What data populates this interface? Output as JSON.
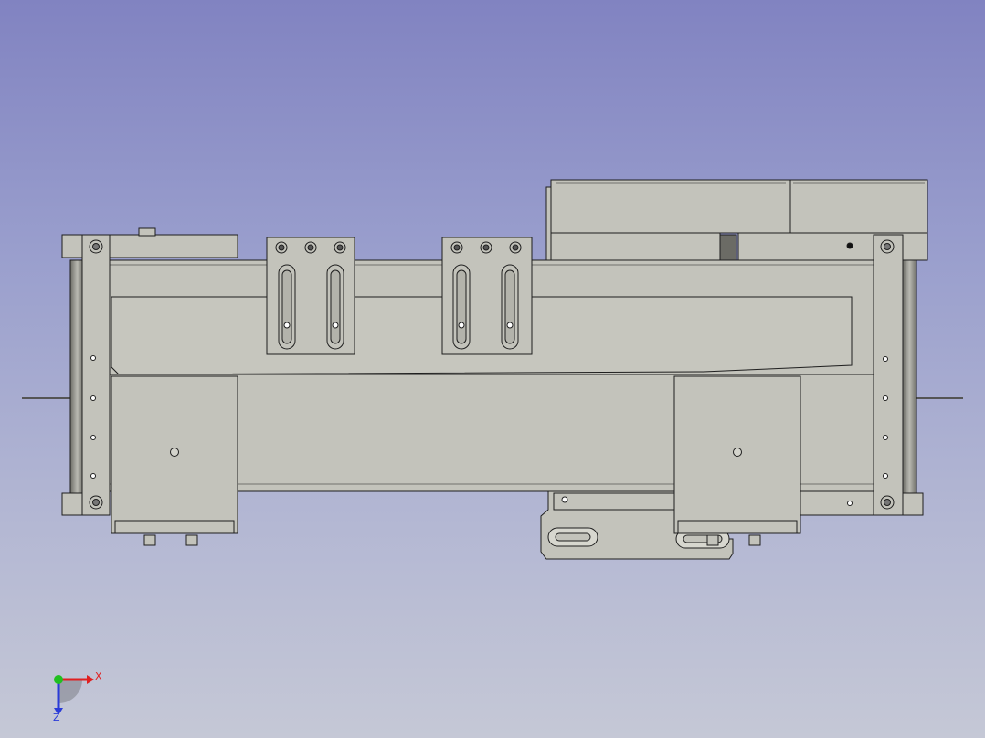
{
  "view": {
    "background_top": "#8183c1",
    "background_bottom": "#c5c8d6",
    "part_fill": "#c3c3bb",
    "part_dark": "#9a9a92",
    "edge_color": "#1e1e1e"
  },
  "axis_cross": {
    "x_label": "X",
    "z_label": "Z",
    "x_color": "#e02020",
    "y_color": "#20c020",
    "z_color": "#2a3bd8",
    "origin_icon": "green-sphere"
  }
}
